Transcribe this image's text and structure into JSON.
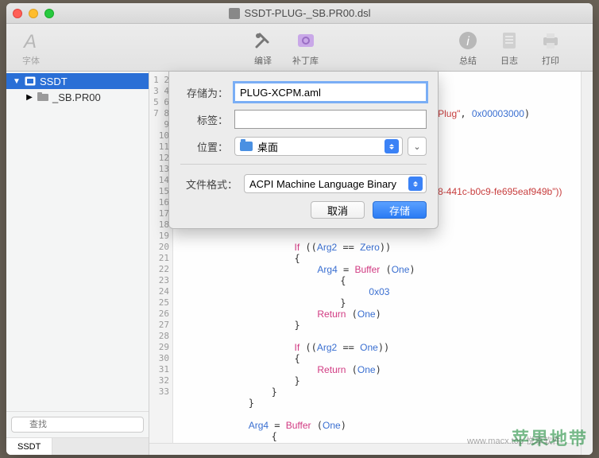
{
  "window": {
    "title": "SSDT-PLUG-_SB.PR00.dsl"
  },
  "toolbar": {
    "font": "字体",
    "compile": "编译",
    "patch": "补丁库",
    "summary": "总结",
    "log": "日志",
    "print": "打印"
  },
  "sidebar": {
    "root": "SSDT",
    "child": "_SB.PR00",
    "search_placeholder": "查找",
    "tab": "SSDT"
  },
  "sheet": {
    "save_as_label": "存储为：",
    "filename": "PLUG-XCPM.aml",
    "tags_label": "标签：",
    "tags_value": "",
    "location_label": "位置：",
    "location_value": "桌面",
    "format_label": "文件格式：",
    "format_value": "ACPI Machine Language Binary",
    "cancel": "取消",
    "save": "存储"
  },
  "gutter_start": 1,
  "gutter_end": 33,
  "code_fragments": {
    "line4_plug": "Plug\"",
    "line4_hex": "0x00003000",
    "line11_tail": "8-441c-b0c9-fe695eaf949b\"))",
    "if": "If",
    "arg2": "Arg2",
    "arg4": "Arg4",
    "zero": "Zero",
    "one": "One",
    "buffer": "Buffer",
    "return": "Return",
    "hex03": "0x03",
    "eq": "=="
  },
  "watermark": {
    "big": "苹果地带",
    "small": "www.macx.top  悦享软件"
  }
}
